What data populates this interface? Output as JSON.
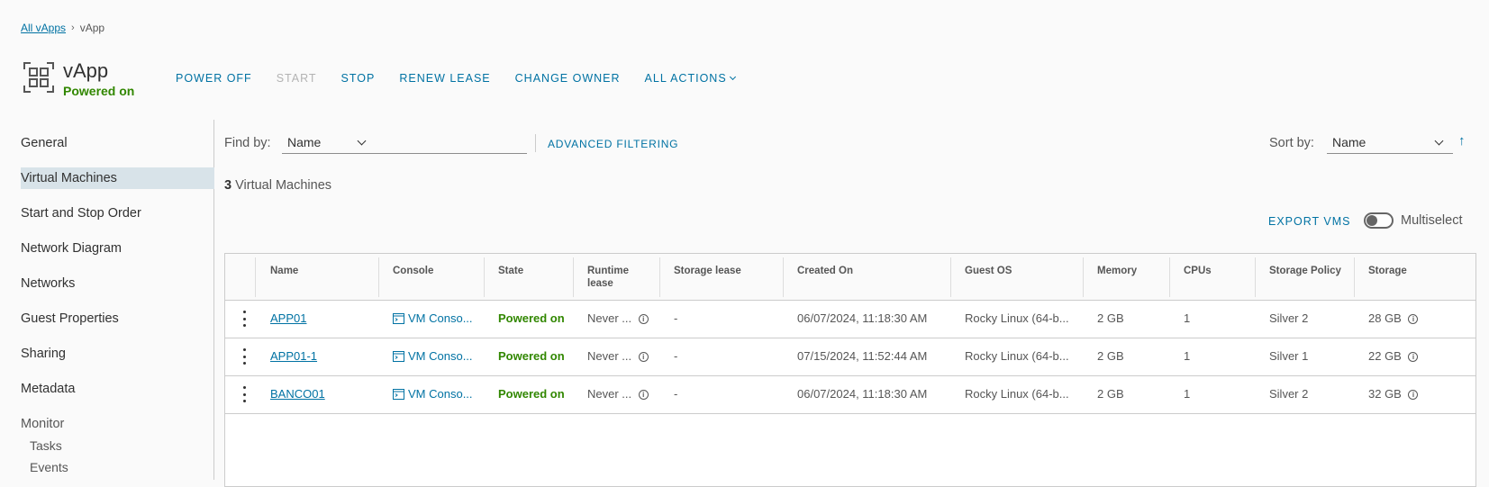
{
  "breadcrumb": {
    "parent": "All vApps",
    "current": "vApp"
  },
  "header": {
    "title": "vApp",
    "status": "Powered on"
  },
  "actions": {
    "power_off": "POWER OFF",
    "start": "START",
    "stop": "STOP",
    "renew_lease": "RENEW LEASE",
    "change_owner": "CHANGE OWNER",
    "all_actions": "ALL ACTIONS"
  },
  "sidebar": {
    "items": [
      {
        "label": "General"
      },
      {
        "label": "Virtual Machines"
      },
      {
        "label": "Start and Stop Order"
      },
      {
        "label": "Network Diagram"
      },
      {
        "label": "Networks"
      },
      {
        "label": "Guest Properties"
      },
      {
        "label": "Sharing"
      },
      {
        "label": "Metadata"
      }
    ],
    "monitor": {
      "label": "Monitor",
      "tasks": "Tasks",
      "events": "Events"
    },
    "active": "Virtual Machines"
  },
  "filter": {
    "find_by_label": "Find by:",
    "find_by_value": "Name",
    "advanced": "ADVANCED FILTERING",
    "sort_by_label": "Sort by:",
    "sort_by_value": "Name",
    "sort_direction": "ascending"
  },
  "count": {
    "number": "3",
    "label": "Virtual Machines"
  },
  "toolbar": {
    "export": "EXPORT VMS",
    "multiselect": "Multiselect",
    "multiselect_on": false
  },
  "table": {
    "columns": [
      "Name",
      "Console",
      "State",
      "Runtime lease",
      "Storage lease",
      "Created On",
      "Guest OS",
      "Memory",
      "CPUs",
      "Storage Policy",
      "Storage"
    ],
    "rows": [
      {
        "name": "APP01",
        "console": "VM Conso...",
        "state": "Powered on",
        "runtime": "Never ...",
        "storage_lease": "-",
        "created": "06/07/2024, 11:18:30 AM",
        "os": "Rocky Linux (64-b...",
        "memory": "2 GB",
        "cpus": "1",
        "policy": "Silver 2",
        "storage": "28 GB"
      },
      {
        "name": "APP01-1",
        "console": "VM Conso...",
        "state": "Powered on",
        "runtime": "Never ...",
        "storage_lease": "-",
        "created": "07/15/2024, 11:52:44 AM",
        "os": "Rocky Linux (64-b...",
        "memory": "2 GB",
        "cpus": "1",
        "policy": "Silver 1",
        "storage": "22 GB"
      },
      {
        "name": "BANCO01",
        "console": "VM Conso...",
        "state": "Powered on",
        "runtime": "Never ...",
        "storage_lease": "-",
        "created": "06/07/2024, 11:18:30 AM",
        "os": "Rocky Linux (64-b...",
        "memory": "2 GB",
        "cpus": "1",
        "policy": "Silver 2",
        "storage": "32 GB"
      }
    ]
  },
  "colors": {
    "accent": "#0072a3",
    "success": "#318700",
    "active_nav": "#d8e3e9"
  }
}
